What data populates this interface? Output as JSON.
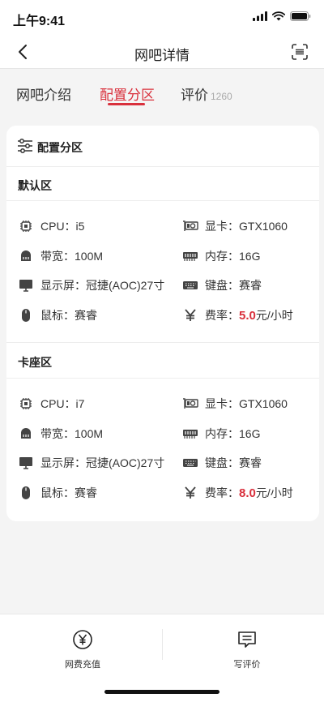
{
  "status": {
    "time": "上午9:41"
  },
  "nav": {
    "title": "网吧详情",
    "back_icon": "chevron-left-icon",
    "scan_icon": "scan-icon"
  },
  "tabs": [
    {
      "label": "网吧介绍"
    },
    {
      "label": "配置分区"
    },
    {
      "label": "评价",
      "count": "1260"
    }
  ],
  "section": {
    "title": "配置分区"
  },
  "zones": [
    {
      "name": "默认区",
      "specs": {
        "cpu": "CPU：i5",
        "gpu": "显卡：GTX1060",
        "bandwidth": "带宽：100M",
        "memory": "内存：16G",
        "monitor": "显示屏：冠捷(AOC)27寸",
        "keyboard": "键盘：赛睿",
        "mouse": "鼠标：赛睿",
        "rate_prefix": "费率：",
        "rate_value": "5.0",
        "rate_unit": "元/小时"
      }
    },
    {
      "name": "卡座区",
      "specs": {
        "cpu": "CPU：i7",
        "gpu": "显卡：GTX1060",
        "bandwidth": "带宽：100M",
        "memory": "内存：16G",
        "monitor": "显示屏：冠捷(AOC)27寸",
        "keyboard": "键盘：赛睿",
        "mouse": "鼠标：赛睿",
        "rate_prefix": "费率：",
        "rate_value": "8.0",
        "rate_unit": "元/小时"
      }
    }
  ],
  "bottom": {
    "recharge": "网费充值",
    "review": "写评价"
  },
  "colors": {
    "accent": "#d9303c"
  }
}
